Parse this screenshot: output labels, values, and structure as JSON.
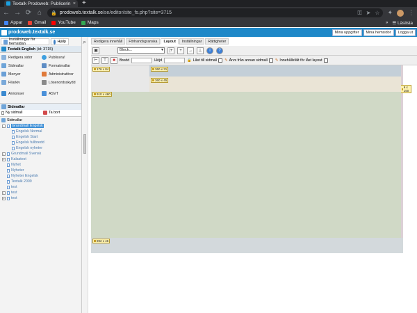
{
  "browser": {
    "tab_title": "Textalk Prodoweb: Publicerin",
    "url_host": "prodoweb.textalk.se",
    "url_path": "/se/editor/site_fs.php?site=3715",
    "bookmarks": [
      "Appar",
      "Gmail",
      "YouTube",
      "Maps"
    ],
    "reading_list": "Läslista"
  },
  "app": {
    "logo": "prodoweb.textalk.se",
    "header_buttons": [
      "Mina uppgifter",
      "Mina hemsidor",
      "Logga ut"
    ]
  },
  "left": {
    "top_tabs": [
      "Inställningar för hemsidan",
      "Hjälp"
    ],
    "site_label": "Textalk English",
    "site_id": "(id: 3715)",
    "menu": [
      {
        "label": "Redigera sidor",
        "icon": "edit-pages-icon"
      },
      {
        "label": "Publicera!",
        "icon": "publish-icon"
      },
      {
        "label": "Sidmallar",
        "icon": "templates-icon"
      },
      {
        "label": "Formatmallar",
        "icon": "styles-icon"
      },
      {
        "label": "Menyer",
        "icon": "menus-icon"
      },
      {
        "label": "Administratörer",
        "icon": "admins-icon"
      },
      {
        "label": "Filarkiv",
        "icon": "file-archive-icon"
      },
      {
        "label": "Lösenordsskydd",
        "icon": "password-icon"
      },
      {
        "label": "Annonser",
        "icon": "ads-icon"
      },
      {
        "label": "ASVT",
        "icon": "asvt-icon"
      }
    ],
    "templates_heading": "Sidmallar",
    "new_template": "Ny sidmall",
    "delete": "Ta bort",
    "tree_root": "Sidmallar",
    "tree": [
      {
        "label": "Grundmall Engelsk",
        "level": 1,
        "expand": "-",
        "selected": true
      },
      {
        "label": "Engelsk Normal",
        "level": 2
      },
      {
        "label": "Engelsk Start",
        "level": 2
      },
      {
        "label": "Engelsk fullbredd",
        "level": 2
      },
      {
        "label": "Engelsk nyheter",
        "level": 2
      },
      {
        "label": "Grundmall Svensk",
        "level": 1,
        "expand": "+"
      },
      {
        "label": "Kalsatest",
        "level": 1,
        "expand": "+"
      },
      {
        "label": "Nyhet",
        "level": 1
      },
      {
        "label": "Nyheter",
        "level": 1
      },
      {
        "label": "Nyheter Engelsk",
        "level": 1
      },
      {
        "label": "Textalk 2009",
        "level": 1
      },
      {
        "label": "test",
        "level": 1
      },
      {
        "label": "test",
        "level": 1,
        "expand": "+"
      },
      {
        "label": "test",
        "level": 1,
        "expand": "+"
      }
    ]
  },
  "editor": {
    "tabs": [
      "Redigera innehåll",
      "Förhandsgranska",
      "Layout",
      "Inställningar",
      "Rättigheter"
    ],
    "active_tab": "Layout",
    "block_select": "Block...",
    "width_label": "Bredd",
    "height_label": "Höjd",
    "options": [
      "Låst till sidmall",
      "Ärvs från annan sidmall",
      "Innehållsfält för låst layout"
    ],
    "blocks": [
      {
        "tag": "176 x 84",
        "color": "#e8e8e8"
      },
      {
        "tag": "360 x 31",
        "color": "#c4cfd8"
      },
      {
        "tag": "6 x 150",
        "color": "#dcd0d6"
      },
      {
        "tag": "360 x 45",
        "color": "#eae4d6"
      },
      {
        "tag": "910 x 460",
        "color": "#d0d9c6"
      },
      {
        "tag": "892 x 46",
        "color": "#d3d9dc"
      }
    ]
  }
}
